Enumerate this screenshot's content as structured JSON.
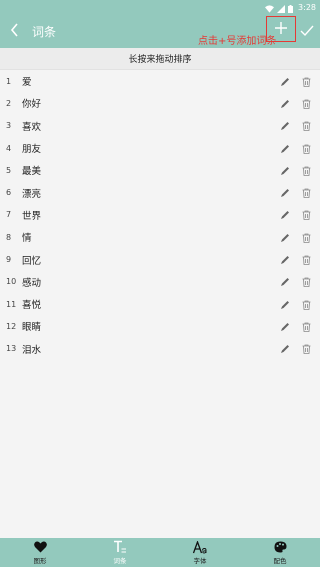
{
  "status_bar": {
    "time": "3:28"
  },
  "app_bar": {
    "title": "词条",
    "annotation": "点击+号添加词条"
  },
  "sort_hint": "长按来拖动排序",
  "items": [
    {
      "num": "1",
      "text": "爱"
    },
    {
      "num": "2",
      "text": "你好"
    },
    {
      "num": "3",
      "text": "喜欢"
    },
    {
      "num": "4",
      "text": "朋友"
    },
    {
      "num": "5",
      "text": "最美"
    },
    {
      "num": "6",
      "text": "漂亮"
    },
    {
      "num": "7",
      "text": "世界"
    },
    {
      "num": "8",
      "text": "情"
    },
    {
      "num": "9",
      "text": "回忆"
    },
    {
      "num": "10",
      "text": "感动"
    },
    {
      "num": "11",
      "text": "喜悦"
    },
    {
      "num": "12",
      "text": "眼睛"
    },
    {
      "num": "13",
      "text": "泪水"
    }
  ],
  "bottom_nav": [
    {
      "label": "图形",
      "icon": "heart-icon"
    },
    {
      "label": "词条",
      "icon": "text-icon",
      "active": true
    },
    {
      "label": "字体",
      "icon": "font-icon"
    },
    {
      "label": "配色",
      "icon": "palette-icon"
    }
  ],
  "colors": {
    "primary": "#93c9bd",
    "annotation": "#e53935",
    "background": "#f4f4f4"
  }
}
